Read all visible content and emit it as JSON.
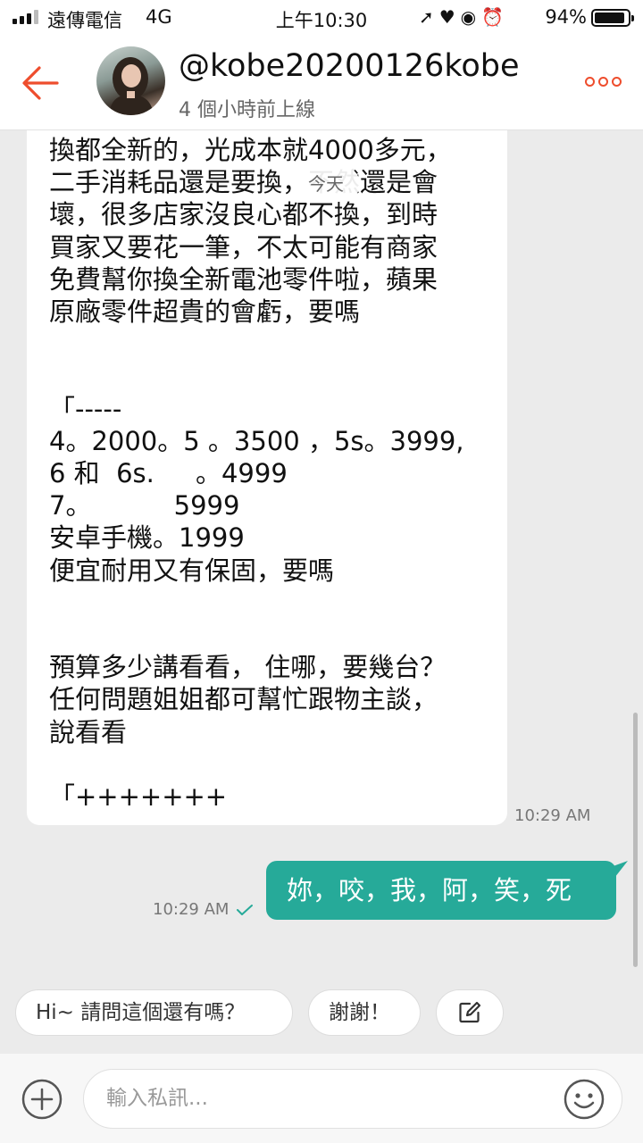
{
  "status_bar": {
    "carrier": "遠傳電信",
    "network": "4G",
    "time": "上午10:30",
    "icons": "➚♥◉⏰",
    "battery": "94%"
  },
  "header": {
    "username": "@kobe20200126kobe",
    "last_seen": "4 個小時前上線"
  },
  "chat": {
    "date_divider": "今天",
    "incoming_text": "換都全新的，光成本就4000多元，\n二手消耗品還是要換，不然還是會\n壞，很多店家沒良心都不換，到時\n買家又要花一筆，不太可能有商家\n免費幫你換全新電池零件啦，蘋果\n原廠零件超貴的會虧，要嗎\n\n\n「-----\n4。2000。5 。3500 ，5s。3999,\n6 和  6s.     。4999\n7。          5999\n安卓手機。1999\n便宜耐用又有保固，要嗎\n\n\n預算多少講看看， 住哪，要幾台？\n任何問題姐姐都可幫忙跟物主談，\n說看看\n\n「+++++++",
    "incoming_time": "10:29 AM",
    "outgoing_text": "妳，咬，我，阿，笑，死",
    "outgoing_time": "10:29 AM"
  },
  "quick_replies": [
    "Hi~ 請問這個還有嗎？",
    "謝謝！"
  ],
  "input": {
    "placeholder": "輸入私訊..."
  },
  "colors": {
    "accent": "#ee4d2d",
    "outgoing_bubble": "#26aa99"
  }
}
